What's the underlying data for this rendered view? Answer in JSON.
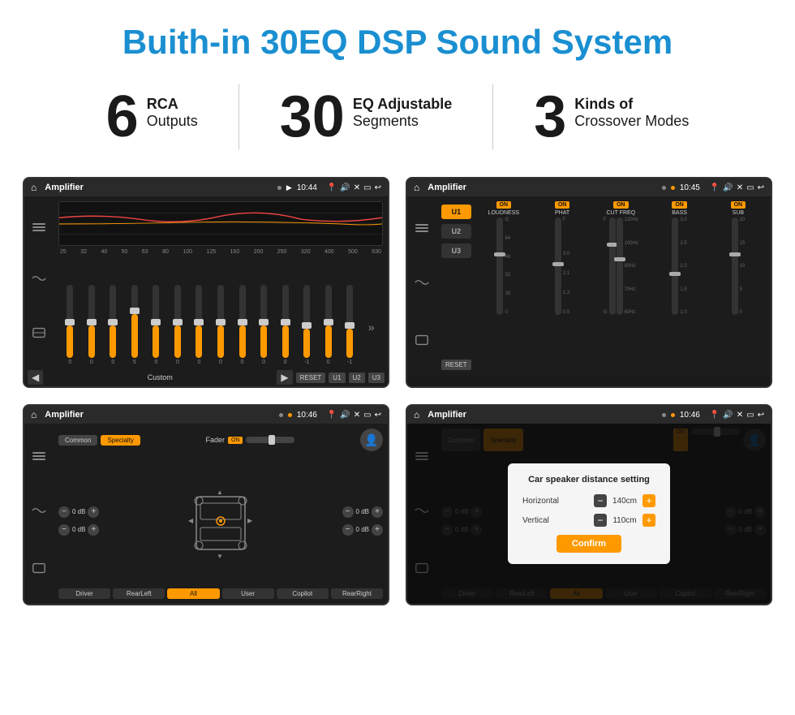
{
  "page": {
    "title": "Buith-in 30EQ DSP Sound System",
    "stats": [
      {
        "number": "6",
        "label_top": "RCA",
        "label_bottom": "Outputs"
      },
      {
        "number": "30",
        "label_top": "EQ Adjustable",
        "label_bottom": "Segments"
      },
      {
        "number": "3",
        "label_top": "Kinds of",
        "label_bottom": "Crossover Modes"
      }
    ]
  },
  "screens": {
    "eq": {
      "app_name": "Amplifier",
      "time": "10:44",
      "freq_labels": [
        "25",
        "32",
        "40",
        "50",
        "63",
        "80",
        "100",
        "125",
        "160",
        "200",
        "250",
        "320",
        "400",
        "500",
        "630"
      ],
      "slider_values": [
        "0",
        "0",
        "0",
        "5",
        "0",
        "0",
        "0",
        "0",
        "0",
        "0",
        "0",
        "-1",
        "0",
        "-1"
      ],
      "preset": "Custom",
      "buttons": [
        "RESET",
        "U1",
        "U2",
        "U3"
      ]
    },
    "crossover": {
      "app_name": "Amplifier",
      "time": "10:45",
      "presets": [
        "U1",
        "U2",
        "U3"
      ],
      "channels": [
        {
          "label": "LOUDNESS",
          "on": true
        },
        {
          "label": "PHAT",
          "on": true
        },
        {
          "label": "CUT FREQ",
          "on": true
        },
        {
          "label": "BASS",
          "on": true
        },
        {
          "label": "SUB",
          "on": true
        }
      ],
      "reset_label": "RESET"
    },
    "fader": {
      "app_name": "Amplifier",
      "time": "10:46",
      "tabs": [
        "Common",
        "Specialty"
      ],
      "active_tab": "Specialty",
      "fader_label": "Fader",
      "fader_on": "ON",
      "controls": [
        {
          "label": "0 dB"
        },
        {
          "label": "0 dB"
        },
        {
          "label": "0 dB"
        },
        {
          "label": "0 dB"
        }
      ],
      "bottom_buttons": [
        "Driver",
        "RearLeft",
        "All",
        "User",
        "Copilot",
        "RearRight"
      ]
    },
    "speaker_dialog": {
      "app_name": "Amplifier",
      "time": "10:46",
      "tabs": [
        "Common",
        "Specialty"
      ],
      "dialog_title": "Car speaker distance setting",
      "horizontal_label": "Horizontal",
      "horizontal_value": "140cm",
      "vertical_label": "Vertical",
      "vertical_value": "110cm",
      "confirm_label": "Confirm",
      "right_controls": [
        {
          "label": "0 dB"
        },
        {
          "label": "0 dB"
        }
      ],
      "bottom_buttons": [
        "Driver",
        "RearLeft",
        "All",
        "User",
        "Copilot",
        "RearRight"
      ]
    }
  }
}
